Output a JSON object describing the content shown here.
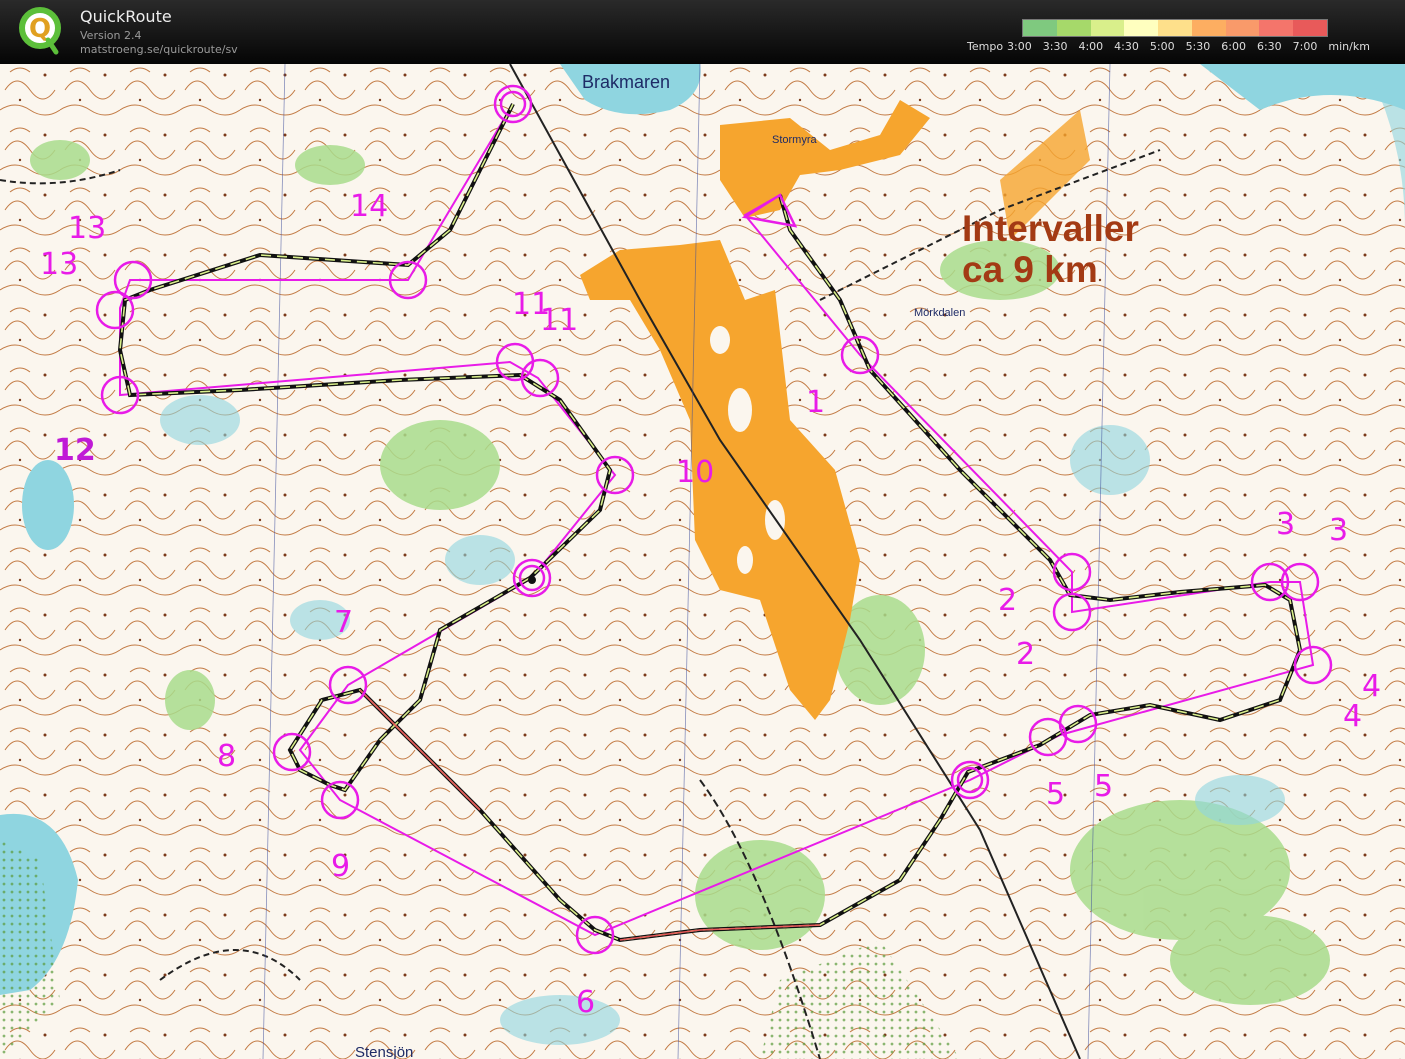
{
  "app": {
    "title": "QuickRoute",
    "version": "Version 2.4",
    "url": "matstroeng.se/quickroute/sv",
    "logo_letter": "Q"
  },
  "tempo_legend": {
    "label": "Tempo",
    "ticks": [
      "3:00",
      "3:30",
      "4:00",
      "4:30",
      "5:00",
      "5:30",
      "6:00",
      "6:30",
      "7:00"
    ],
    "unit": "min/km",
    "gradient_colors": [
      "#7fc97f",
      "#a6d96a",
      "#d9ef8b",
      "#ffffbf",
      "#fee08b",
      "#fdae61",
      "#f99a6a",
      "#f4756b",
      "#e85a5a"
    ]
  },
  "map": {
    "place_names": [
      "Brakmaren",
      "Stormyra",
      "Mörkdalen",
      "Stensjön"
    ],
    "annotation_line1": "Intervaller",
    "annotation_line2": "ca 9 km",
    "colors": {
      "course": "#e81be8",
      "route": "#1a1a1a",
      "annotation": "#a33a14",
      "marsh_open": "#f6a52e",
      "water": "#8fd5e0",
      "vegetation": "#9ad67a",
      "contour": "#b5652e"
    },
    "control_labels": [
      {
        "text": "1"
      },
      {
        "text": "2"
      },
      {
        "text": "2"
      },
      {
        "text": "3"
      },
      {
        "text": "3"
      },
      {
        "text": "4"
      },
      {
        "text": "4"
      },
      {
        "text": "5"
      },
      {
        "text": "5"
      },
      {
        "text": "6"
      },
      {
        "text": "7"
      },
      {
        "text": "8"
      },
      {
        "text": "9"
      },
      {
        "text": "10"
      },
      {
        "text": "11"
      },
      {
        "text": "11"
      },
      {
        "text": "12"
      },
      {
        "text": "13"
      },
      {
        "text": "13"
      },
      {
        "text": "14"
      }
    ]
  }
}
